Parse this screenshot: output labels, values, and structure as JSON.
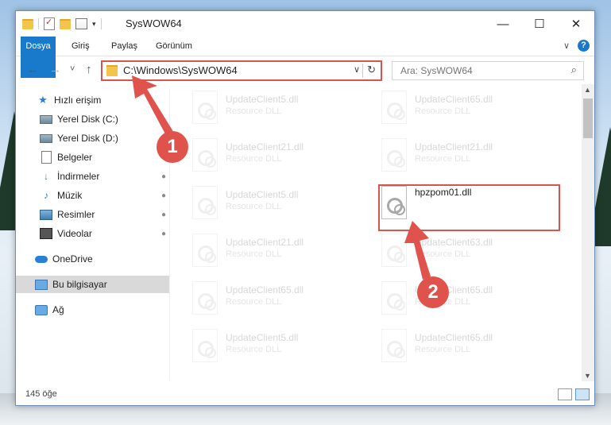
{
  "window": {
    "title": "SysWOW64",
    "minimize": "—",
    "maximize": "☐",
    "close": "✕"
  },
  "ribbon": {
    "tabs": [
      "Dosya",
      "Giriş",
      "Paylaş",
      "Görünüm"
    ],
    "expand": "∨",
    "help": "?"
  },
  "nav": {
    "back": "←",
    "forward": "→",
    "recent": "˅",
    "up": "↑",
    "address": "C:\\Windows\\SysWOW64",
    "address_dropdown": "∨",
    "refresh": "↻",
    "search_placeholder": "Ara: SysWOW64",
    "search_icon": "⌕"
  },
  "sidebar": {
    "items": [
      {
        "label": "Hızlı erişim",
        "icon": "quick-access-star-icon"
      },
      {
        "label": "Yerel Disk (C:)",
        "icon": "drive-icon",
        "pinned": true
      },
      {
        "label": "Yerel Disk (D:)",
        "icon": "drive-icon",
        "pinned": true
      },
      {
        "label": "Belgeler",
        "icon": "documents-icon",
        "pinned": true
      },
      {
        "label": "İndirmeler",
        "icon": "downloads-icon",
        "pinned": true
      },
      {
        "label": "Müzik",
        "icon": "music-icon",
        "pinned": true
      },
      {
        "label": "Resimler",
        "icon": "pictures-icon",
        "pinned": true
      },
      {
        "label": "Videolar",
        "icon": "videos-icon",
        "pinned": true
      },
      {
        "label": "OneDrive",
        "icon": "onedrive-icon"
      },
      {
        "label": "Bu bilgisayar",
        "icon": "this-pc-icon",
        "selected": true
      },
      {
        "label": "Ağ",
        "icon": "network-icon"
      }
    ],
    "pin_glyph": "📌"
  },
  "files": {
    "left": [
      {
        "name": "UpdateClient5.dll",
        "desc": "Resource DLL"
      },
      {
        "name": "UpdateClient21.dll",
        "desc": "Resource DLL"
      },
      {
        "name": "UpdateClient5.dll",
        "desc": "Resource DLL"
      },
      {
        "name": "UpdateClient21.dll",
        "desc": "Resource DLL"
      },
      {
        "name": "UpdateClient65.dll",
        "desc": "Resource DLL"
      },
      {
        "name": "UpdateClient5.dll",
        "desc": "Resource DLL"
      }
    ],
    "right": [
      {
        "name": "UpdateClient65.dll",
        "desc": "Resource DLL"
      },
      {
        "name": "UpdateClient21.dll",
        "desc": "Resource DLL"
      },
      {
        "name": "hpzpom01.dll",
        "desc": "",
        "highlight": true
      },
      {
        "name": "UpdateClient63.dll",
        "desc": "Resource DLL"
      },
      {
        "name": "UpdateClient65.dll",
        "desc": "Resource DLL"
      },
      {
        "name": "UpdateClient65.dll",
        "desc": "Resource DLL"
      }
    ]
  },
  "status": {
    "count": "145 öğe"
  },
  "annotations": {
    "marker1": "1",
    "marker2": "2",
    "color": "#e0524c"
  }
}
